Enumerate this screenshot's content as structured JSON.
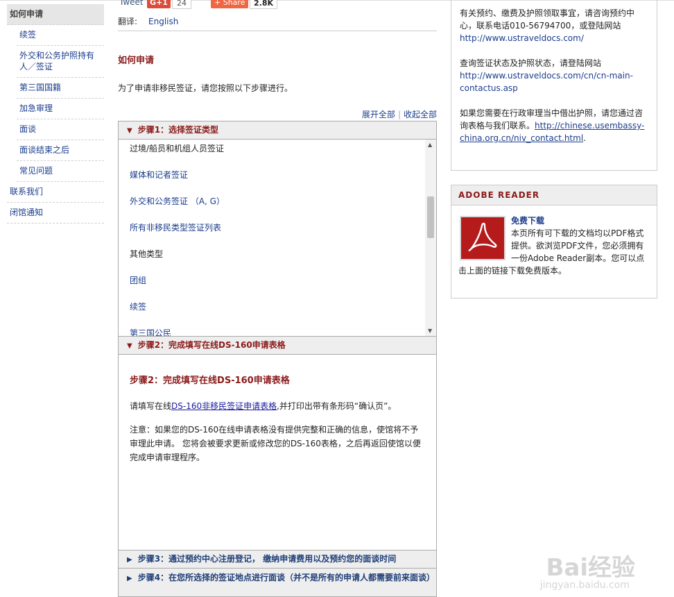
{
  "sidebar": {
    "items": [
      {
        "label": "如何申请",
        "type": "active"
      },
      {
        "label": "续签",
        "type": "sub"
      },
      {
        "label": "外交和公务护照持有人／签证",
        "type": "sub"
      },
      {
        "label": "第三国国籍",
        "type": "sub"
      },
      {
        "label": "加急审理",
        "type": "sub"
      },
      {
        "label": "面谈",
        "type": "sub"
      },
      {
        "label": "面谈结束之后",
        "type": "sub"
      },
      {
        "label": "常见问题",
        "type": "sub"
      },
      {
        "label": "联系我们",
        "type": "top"
      },
      {
        "label": "闭馆通知",
        "type": "top"
      }
    ]
  },
  "social": {
    "tweet": "Tweet",
    "gplus": "G+1",
    "gplus_count": "24",
    "share": "+ Share",
    "share_count": "2.8K"
  },
  "translate": {
    "label": "翻译:",
    "link": "English"
  },
  "page_title": "如何申请",
  "intro": "为了申请非移民签证，请您按照以下步骤进行。",
  "expand": {
    "expand_all": "展开全部",
    "collapse_all": "收起全部",
    "separator": "|"
  },
  "accordion": {
    "step1": {
      "title": "步骤1：选择签证类型"
    },
    "step1_items": [
      {
        "label": "过境/船员和机组人员签证",
        "link": false
      },
      {
        "label": "媒体和记者签证",
        "link": true
      },
      {
        "label": "外交和公务签证 （A, G）",
        "link": true
      },
      {
        "label": "所有非移民类型签证列表",
        "link": true
      },
      {
        "label": "其他类型",
        "link": false
      },
      {
        "label": "团组",
        "link": true
      },
      {
        "label": "续签",
        "link": true
      },
      {
        "label": "第三国公民",
        "link": true
      }
    ],
    "step2": {
      "title": "步骤2：完成填写在线DS-160申请表格",
      "heading": "步骤2：完成填写在线DS-160申请表格",
      "p1_pre": "请填写在线",
      "p1_link": "DS-160非移民签证申请表格",
      "p1_post": ",并打印出带有条形码“确认页”。",
      "p2": "注意：如果您的DS-160在线申请表格没有提供完整和正确的信息，使馆将不予审理此申请。 您将会被要求更新或修改您的DS-160表格，之后再返回使馆以便完成申请审理程序。"
    },
    "step3": {
      "title": "步骤3：通过预约中心注册登记， 缴纳申请费用以及预约您的面谈时间"
    },
    "step4": {
      "title": "步骤4：在您所选择的签证地点进行面谈（并不是所有的申请人都需要前来面谈）"
    }
  },
  "right": {
    "box1": {
      "p1_text": "有关预约、缴费及护照领取事宜，请咨询预约中心，联系电话010-56794700，或登陆网站",
      "p1_link": "http://www.ustraveldocs.com/",
      "p2_text": "查询签证状态及护照状态，请登陆网站",
      "p2_link": "http://www.ustraveldocs.com/cn/cn-main-contactus.asp",
      "p3_text": "如果您需要在行政审理当中借出护照，请您通过咨询表格与我们联系。",
      "p3_link": "http://chinese.usembassy-china.org.cn/niv_contact.html",
      "p3_end": "."
    },
    "box2": {
      "title": "ADOBE READER",
      "download": "免费下载",
      "text": "本页所有可下载的文档均以PDF格式提供。欲浏览PDF文件，您必须拥有一份Adobe Reader副本。您可以点击上面的链接下载免费版本。"
    }
  },
  "watermark": {
    "main": "Bai经验",
    "sub": "jingyan.baidu.com"
  },
  "icons": [
    "triangle-down-icon",
    "triangle-right-icon",
    "pdf-icon",
    "scroll-up-icon",
    "scroll-down-icon"
  ],
  "colors": {
    "heading_red": "#8b1a1a",
    "link_blue": "#1a3c8c",
    "pdf_red": "#b61b1b"
  }
}
